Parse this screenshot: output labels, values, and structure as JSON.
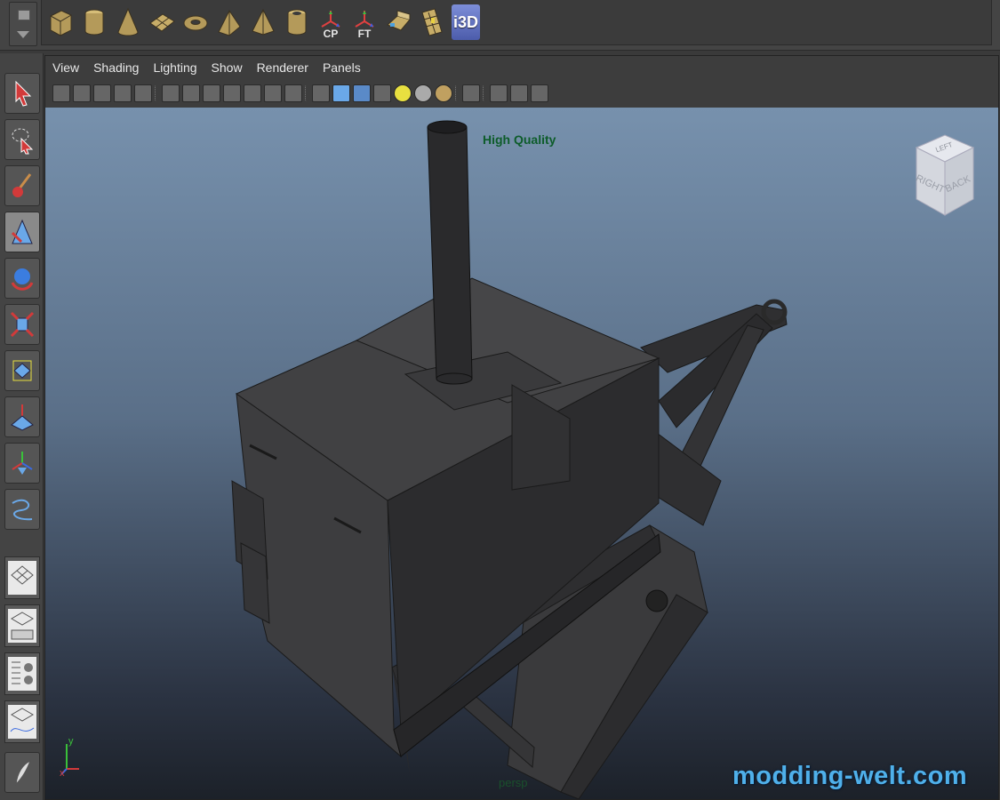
{
  "shelf": {
    "icons": [
      {
        "name": "poly-cube-icon"
      },
      {
        "name": "poly-cylinder-icon"
      },
      {
        "name": "poly-cone-icon"
      },
      {
        "name": "poly-plane-icon"
      },
      {
        "name": "poly-torus-icon"
      },
      {
        "name": "poly-prism-icon"
      },
      {
        "name": "poly-pyramid-icon"
      },
      {
        "name": "poly-pipe-icon"
      },
      {
        "name": "cp-icon",
        "label": "CP"
      },
      {
        "name": "ft-icon",
        "label": "FT"
      },
      {
        "name": "uv-map-icon"
      },
      {
        "name": "texture-map-icon"
      },
      {
        "name": "i3d-icon",
        "label": "i3D"
      }
    ]
  },
  "panel": {
    "menus": [
      "View",
      "Shading",
      "Lighting",
      "Show",
      "Renderer",
      "Panels"
    ]
  },
  "viewport": {
    "quality_label": "High Quality",
    "camera_label": "persp",
    "viewcube": {
      "top": "LEFT",
      "right": "BACK",
      "front": "RIGHT"
    },
    "axis": {
      "x": "x",
      "y": "y"
    }
  },
  "watermark": "modding-welt.com",
  "colors": {
    "viewport_top": "#7791ad",
    "viewport_bottom": "#1c2129",
    "model": "#3b3b3d",
    "watermark": "#4fb0ea",
    "quality_text": "#0d5c2a"
  }
}
